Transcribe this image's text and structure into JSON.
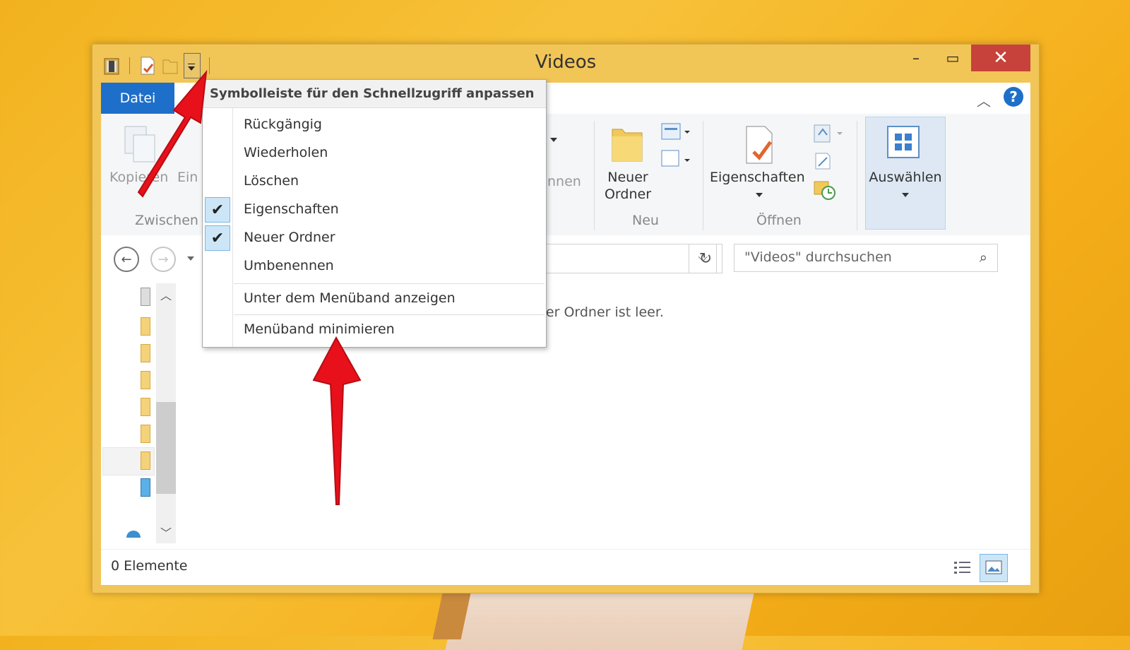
{
  "window": {
    "title": "Videos",
    "minimize_label": "–",
    "maximize_label": "▭",
    "close_label": "✕"
  },
  "tabs": {
    "datei": "Datei"
  },
  "ribbon": {
    "kopieren": "Kopieren",
    "einfuegen_partial": "Ein",
    "zwischenablage_partial": "Zwischen",
    "umbenennen_partial": "nnen",
    "neuer_ordner_line1": "Neuer",
    "neuer_ordner_line2": "Ordner",
    "neu_group": "Neu",
    "eigenschaften": "Eigenschaften",
    "oeffnen_group": "Öffnen",
    "auswaehlen": "Auswählen"
  },
  "nav": {
    "search_placeholder": "\"Videos\" durchsuchen"
  },
  "content": {
    "empty_message": "ser Ordner ist leer."
  },
  "status": {
    "items": "0 Elemente"
  },
  "menu": {
    "header": "Symbolleiste für den Schnellzugriff anpassen",
    "items": [
      {
        "label": "Rückgängig",
        "checked": false
      },
      {
        "label": "Wiederholen",
        "checked": false
      },
      {
        "label": "Löschen",
        "checked": false
      },
      {
        "label": "Eigenschaften",
        "checked": true
      },
      {
        "label": "Neuer Ordner",
        "checked": true
      },
      {
        "label": "Umbenennen",
        "checked": false
      }
    ],
    "show_below": "Unter dem Menüband anzeigen",
    "minimize_ribbon": "Menüband minimieren",
    "check_glyph": "✔"
  },
  "colors": {
    "accent": "#1e6fc9",
    "close": "#c7423a",
    "arrow": "#e8101a",
    "window_frame": "#f2c557"
  }
}
